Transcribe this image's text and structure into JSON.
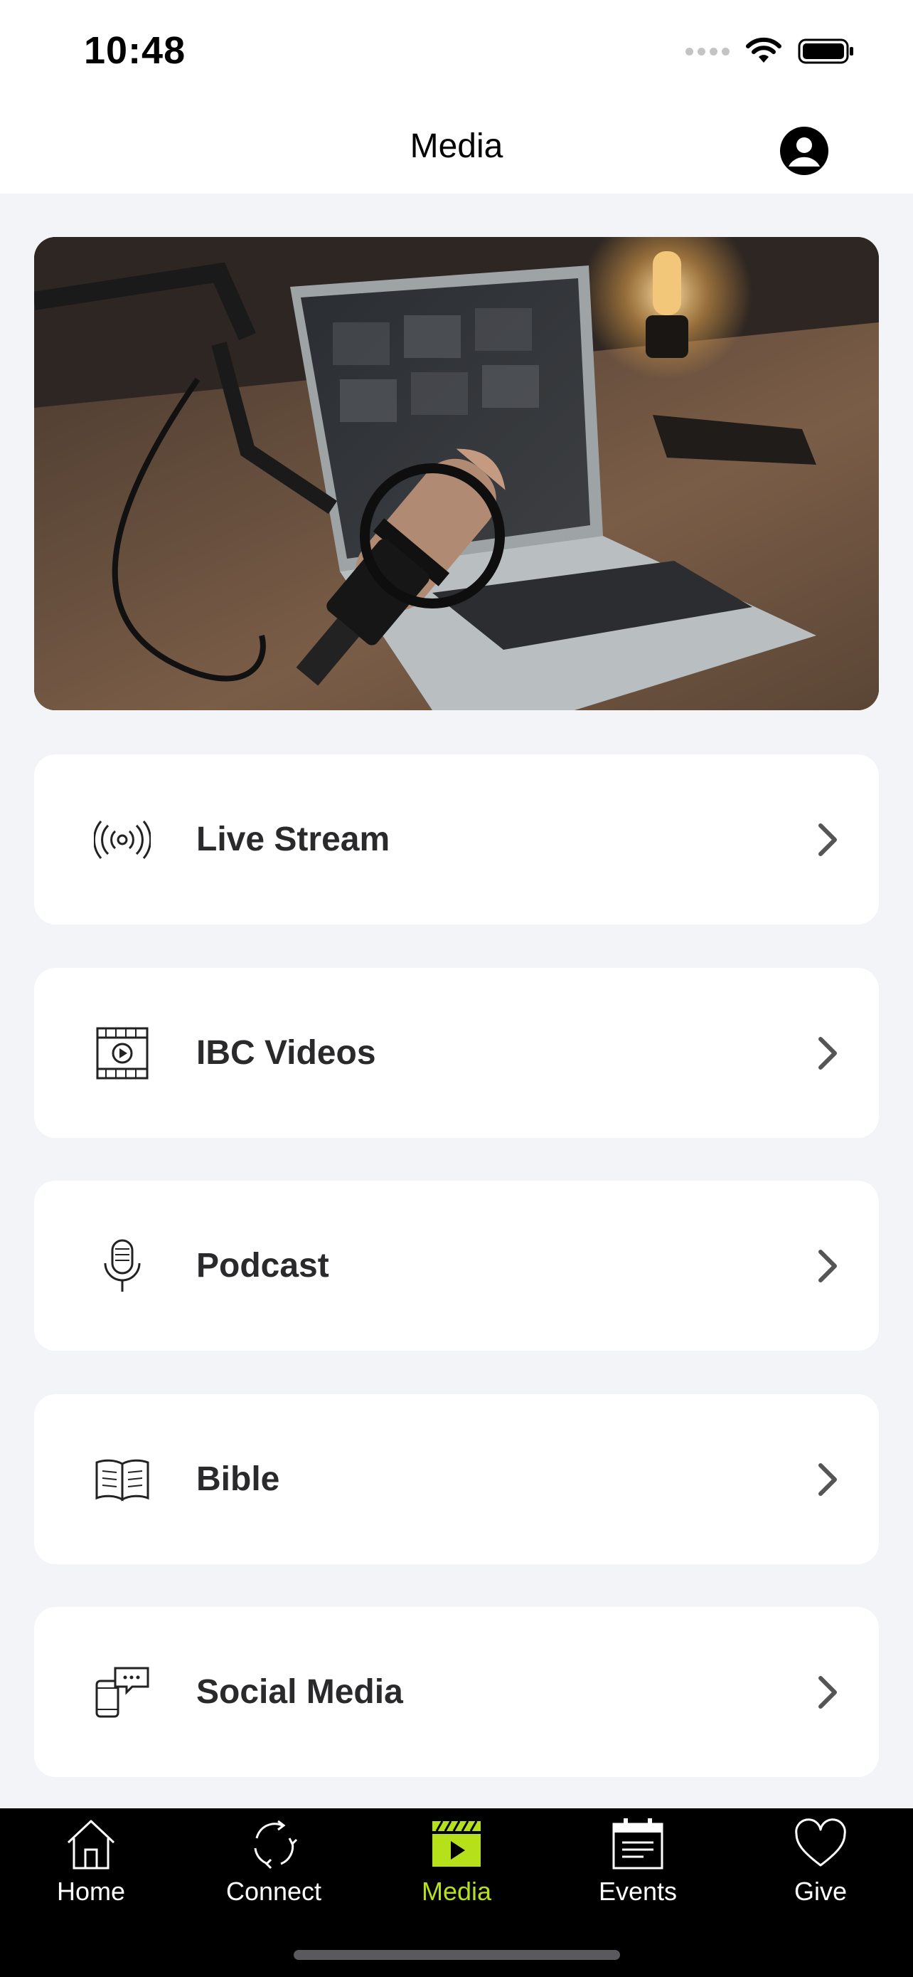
{
  "status_bar": {
    "time": "10:48"
  },
  "nav": {
    "title": "Media"
  },
  "hero": {
    "icon": "podcast-microphone-photo"
  },
  "menu": [
    {
      "label": "Live Stream",
      "icon": "broadcast-icon"
    },
    {
      "label": "IBC Videos",
      "icon": "video-film-icon"
    },
    {
      "label": "Podcast",
      "icon": "microphone-icon"
    },
    {
      "label": "Bible",
      "icon": "open-book-icon"
    },
    {
      "label": "Social Media",
      "icon": "phone-chat-icon"
    }
  ],
  "tabs": [
    {
      "label": "Home",
      "icon": "house-icon",
      "active": false
    },
    {
      "label": "Connect",
      "icon": "cycle-arrows-icon",
      "active": false
    },
    {
      "label": "Media",
      "icon": "clapperboard-icon",
      "active": true
    },
    {
      "label": "Events",
      "icon": "calendar-icon",
      "active": false
    },
    {
      "label": "Give",
      "icon": "heart-icon",
      "active": false
    }
  ],
  "colors": {
    "accent": "#b6e01a",
    "background": "#f2f4f8",
    "tab_bar": "#000000"
  }
}
